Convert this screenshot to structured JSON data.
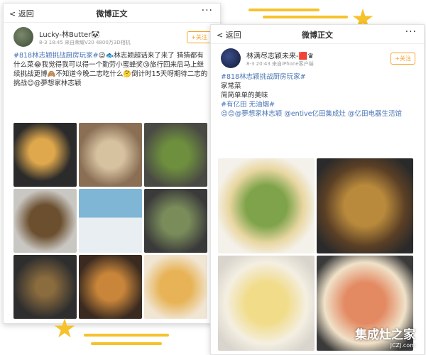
{
  "post1": {
    "nav": {
      "back": "返回",
      "title": "微博正文",
      "more": "···"
    },
    "user": {
      "name": "Lucky-林Butter🐼",
      "meta": "8-3 18:45 来自荣耀V20 4800万3D相机",
      "follow": "+关注"
    },
    "text_hashtag": "#818林志颖挑战厨房玩家#",
    "text_body": "😉🐟林志颖超话来了来了 猜猜都有什么菜😂我觉得我可以得一个勤劳小蜜蜂奖😘旅行回来后马上继续挑战更博🙈不知道今晚二志吃什么🤔倒计时15天呀期待二志的挑战😊@夢想家林志颖"
  },
  "post2": {
    "nav": {
      "back": "返回",
      "title": "微博正文",
      "more": "···"
    },
    "user": {
      "name": "林满尽志颖未来-🟥♛",
      "meta": "8-3 20:43 来自iPhone客户端",
      "follow": "+关注"
    },
    "text_hashtag": "#818林志颖挑战厨房玩家#",
    "lines": [
      "家常菜",
      "简简单单的美味",
      "#有亿田 无油烟#"
    ],
    "mentions": "😉😊@夢想家林志颖 @entive亿田集成灶 @亿田电器生活馆"
  },
  "watermark": {
    "main": "集成灶之家",
    "sub": "JCZJ.com"
  }
}
